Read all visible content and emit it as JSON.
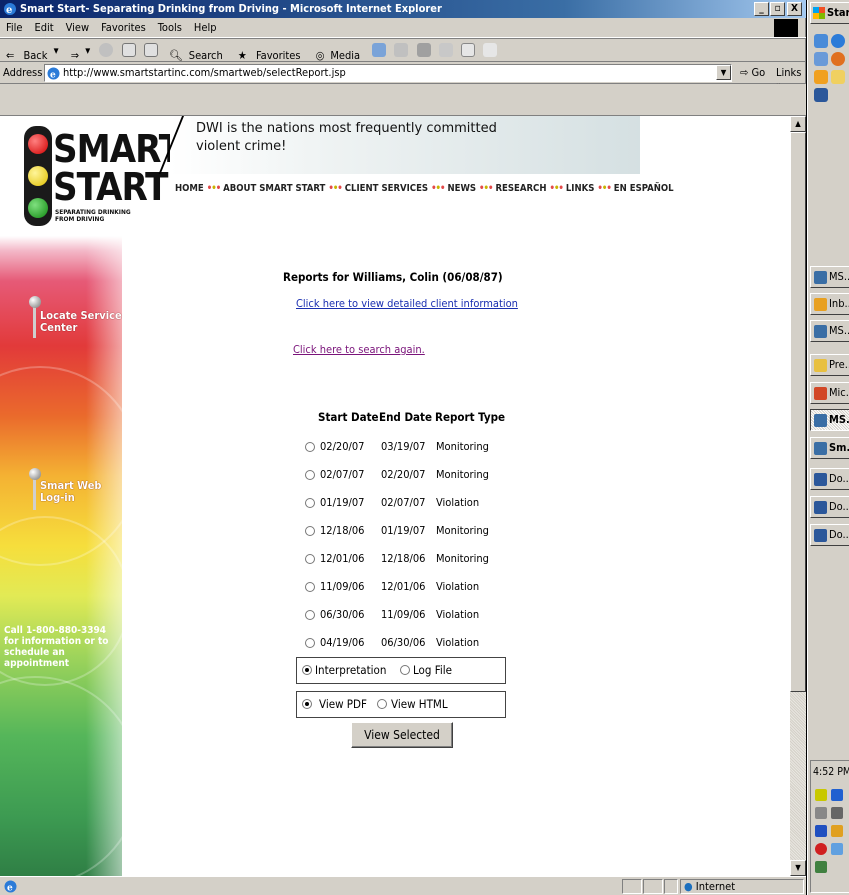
{
  "window": {
    "title": "Smart Start- Separating Drinking from Driving - Microsoft Internet Explorer",
    "minimize": "_",
    "maximize": "▫",
    "close": "X"
  },
  "menu": [
    "File",
    "Edit",
    "View",
    "Favorites",
    "Tools",
    "Help"
  ],
  "toolbar": {
    "back": "Back",
    "search": "Search",
    "favorites": "Favorites",
    "media": "Media"
  },
  "address": {
    "label": "Address",
    "url": "http://www.smartstartinc.com/smartweb/selectReport.jsp",
    "go": "Go",
    "links": "Links"
  },
  "logo": {
    "word1": "SMART",
    "word2": "START",
    "tagline1": "SEPARATING DRINKING",
    "tagline2": "FROM DRIVING"
  },
  "banner": {
    "line1": "DWI is the nations most frequently committed",
    "line2": "violent crime!"
  },
  "topnav": [
    "HOME",
    "ABOUT SMART START",
    "CLIENT SERVICES",
    "NEWS",
    "RESEARCH",
    "LINKS",
    "EN ESPAÑOL"
  ],
  "leftnav": {
    "locate_line1": "Locate Service",
    "locate_line2": "Center",
    "smartweb_line1": "Smart Web",
    "smartweb_line2": "Log-in",
    "phone_line1": "Call 1-800-880-3394",
    "phone_line2": "for information or to",
    "phone_line3": "schedule an appointment"
  },
  "report": {
    "title": "Reports for Williams, Colin (06/08/87)",
    "details_link": "Click here to view detailed client information",
    "search_link": "Click here to search again.",
    "headers": {
      "start": "Start Date",
      "end": "End Date",
      "type": "Report Type"
    },
    "rows": [
      {
        "start": "02/20/07",
        "end": "03/19/07",
        "type": "Monitoring"
      },
      {
        "start": "02/07/07",
        "end": "02/20/07",
        "type": "Monitoring"
      },
      {
        "start": "01/19/07",
        "end": "02/07/07",
        "type": "Violation"
      },
      {
        "start": "12/18/06",
        "end": "01/19/07",
        "type": "Monitoring"
      },
      {
        "start": "12/01/06",
        "end": "12/18/06",
        "type": "Monitoring"
      },
      {
        "start": "11/09/06",
        "end": "12/01/06",
        "type": "Violation"
      },
      {
        "start": "06/30/06",
        "end": "11/09/06",
        "type": "Violation"
      },
      {
        "start": "04/19/06",
        "end": "06/30/06",
        "type": "Violation"
      }
    ],
    "mode_options": {
      "interpretation": "Interpretation",
      "logfile": "Log File",
      "selected": "interpretation"
    },
    "format_options": {
      "pdf": "View PDF",
      "html": "View HTML",
      "selected": "pdf"
    },
    "submit": "View Selected"
  },
  "statusbar": {
    "zone": "Internet"
  },
  "taskbar": {
    "start": "Start",
    "items": [
      {
        "label": "MS...",
        "color": "#3a6ea5",
        "active": false
      },
      {
        "label": "Inb...",
        "color": "#e8a020",
        "active": false
      },
      {
        "label": "MS...",
        "color": "#3a6ea5",
        "active": false
      },
      {
        "label": "Pre...",
        "color": "#e8c040",
        "active": false
      },
      {
        "label": "Mic...",
        "color": "#d24726",
        "active": false
      },
      {
        "label": "MS...",
        "color": "#3a6ea5",
        "active": true
      },
      {
        "label": "Sm...",
        "color": "#3a6ea5",
        "active": false
      },
      {
        "label": "Do...",
        "color": "#2b579a",
        "active": false
      },
      {
        "label": "Do...",
        "color": "#2b579a",
        "active": false
      },
      {
        "label": "Do...",
        "color": "#2b579a",
        "active": false
      }
    ],
    "clock": "4:52 PM"
  }
}
